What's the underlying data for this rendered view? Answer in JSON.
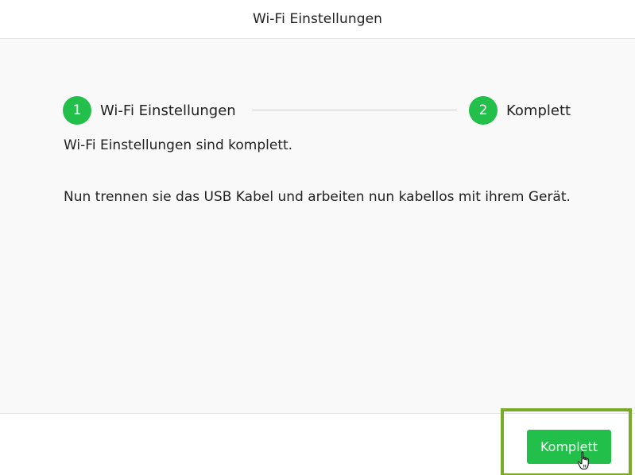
{
  "dialog": {
    "title": "Wi-Fi Einstellungen"
  },
  "stepper": {
    "steps": [
      {
        "number": "1",
        "label": "Wi-Fi Einstellungen",
        "state": "complete"
      },
      {
        "number": "2",
        "label": "Komplett",
        "state": "complete"
      }
    ]
  },
  "content": {
    "message_1": "Wi-Fi Einstellungen sind komplett.",
    "message_2": "Nun trennen sie das USB Kabel und arbeiten nun kabellos mit ihrem Gerät."
  },
  "footer": {
    "complete_button_label": "Komplett"
  },
  "colors": {
    "accent": "#22c04a",
    "highlight": "#7aaa2a",
    "body_background": "#f9f9f9"
  },
  "icons": {
    "cursor": "hand-pointer-icon"
  }
}
